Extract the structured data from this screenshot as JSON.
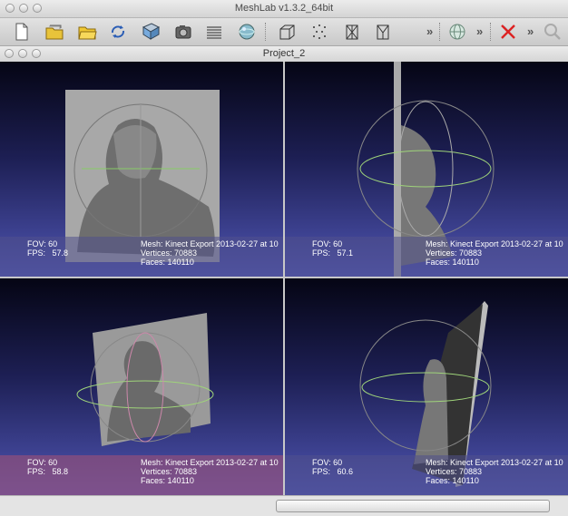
{
  "window": {
    "title": "MeshLab v1.3.2_64bit"
  },
  "project": {
    "title": "Project_2"
  },
  "toolbar": {
    "icons": [
      "new-document-icon",
      "open-layers-icon",
      "open-folder-icon",
      "reload-icon",
      "save-icon",
      "snapshot-icon",
      "layers-icon",
      "sphere-icon",
      "box-icon",
      "points-icon",
      "wireframe-icon",
      "hidden-lines-icon",
      "globe-icon",
      "delete-icon",
      "search-icon"
    ]
  },
  "views": [
    {
      "fov_label": "FOV: 60",
      "fps_label": "FPS:",
      "fps_value": "57.8",
      "mesh": "Mesh: Kinect Export 2013-02-27 at 10",
      "vertices": "Vertices: 70883",
      "faces": "Faces: 140110"
    },
    {
      "fov_label": "FOV: 60",
      "fps_label": "FPS:",
      "fps_value": "57.1",
      "mesh": "Mesh: Kinect Export 2013-02-27 at 10",
      "vertices": "Vertices: 70883",
      "faces": "Faces: 140110"
    },
    {
      "fov_label": "FOV: 60",
      "fps_label": "FPS:",
      "fps_value": "58.8",
      "mesh": "Mesh: Kinect Export 2013-02-27 at 10",
      "vertices": "Vertices: 70883",
      "faces": "Faces: 140110"
    },
    {
      "fov_label": "FOV: 60",
      "fps_label": "FPS:",
      "fps_value": "60.6",
      "mesh": "Mesh: Kinect Export 2013-02-27 at 10",
      "vertices": "Vertices: 70883",
      "faces": "Faces: 140110"
    }
  ],
  "colors": {
    "active_info": "#a0527a",
    "info": "#50508c"
  }
}
